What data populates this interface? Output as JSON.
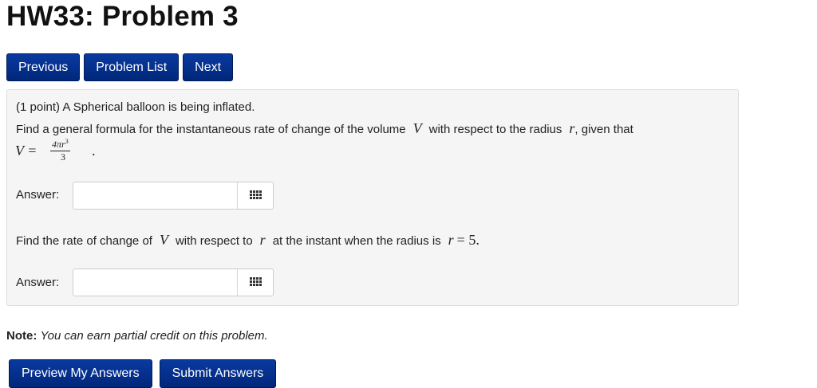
{
  "page": {
    "title": "HW33: Problem 3"
  },
  "nav": {
    "previous_label": "Previous",
    "problem_list_label": "Problem List",
    "next_label": "Next"
  },
  "problem": {
    "line1": "(1 point) A Spherical balloon is being inflated.",
    "line2_a": "Find a general formula for the instantaneous rate of change of the volume",
    "line2_var_v": "V",
    "line2_b": "with respect to the radius",
    "line2_var_r": "r",
    "line2_c": ", given that",
    "formula_lhs": "V =",
    "formula_num": "4πr",
    "formula_exp": "3",
    "formula_den": "3",
    "formula_end": ".",
    "answer1_label": "Answer:",
    "answer1_value": "",
    "line3_a": "Find the rate of change of",
    "line3_var_v": "V",
    "line3_b": "with respect to",
    "line3_var_r": "r",
    "line3_c": "at the instant when the radius is",
    "line3_eq_var": "r",
    "line3_eq_rest": "= 5.",
    "answer2_label": "Answer:",
    "answer2_value": ""
  },
  "note": {
    "label": "Note:",
    "text": "You can earn partial credit on this problem."
  },
  "actions": {
    "preview_label": "Preview My Answers",
    "submit_label": "Submit Answers"
  },
  "icons": {
    "equation_editor": "grid-icon"
  },
  "colors": {
    "button_bg": "#00277a",
    "panel_bg": "#f5f5f5"
  }
}
